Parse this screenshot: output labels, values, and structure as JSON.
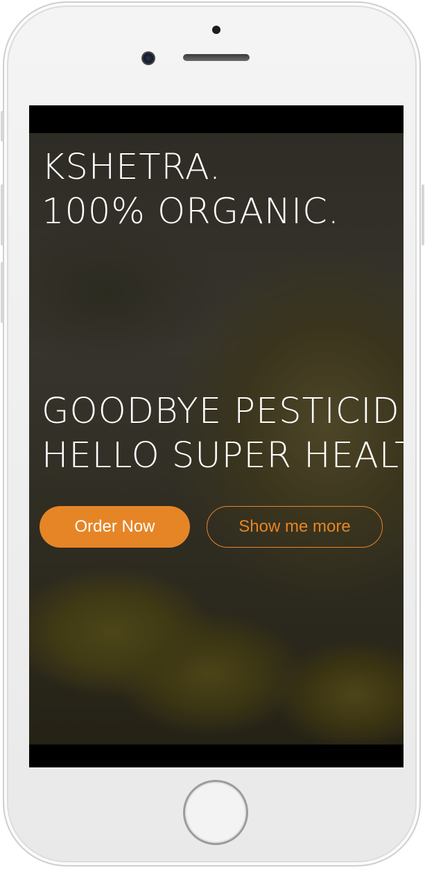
{
  "hero": {
    "headline_1": "KSHETRA.\n100% ORGANIC.",
    "headline_2": "GOODBYE PESTICIDES.\nHELLO SUPER HEALTH.",
    "order_button": "Order Now",
    "more_button": "Show me more"
  },
  "colors": {
    "accent": "#e68526",
    "text": "#ffffff",
    "overlay": "#141210"
  }
}
